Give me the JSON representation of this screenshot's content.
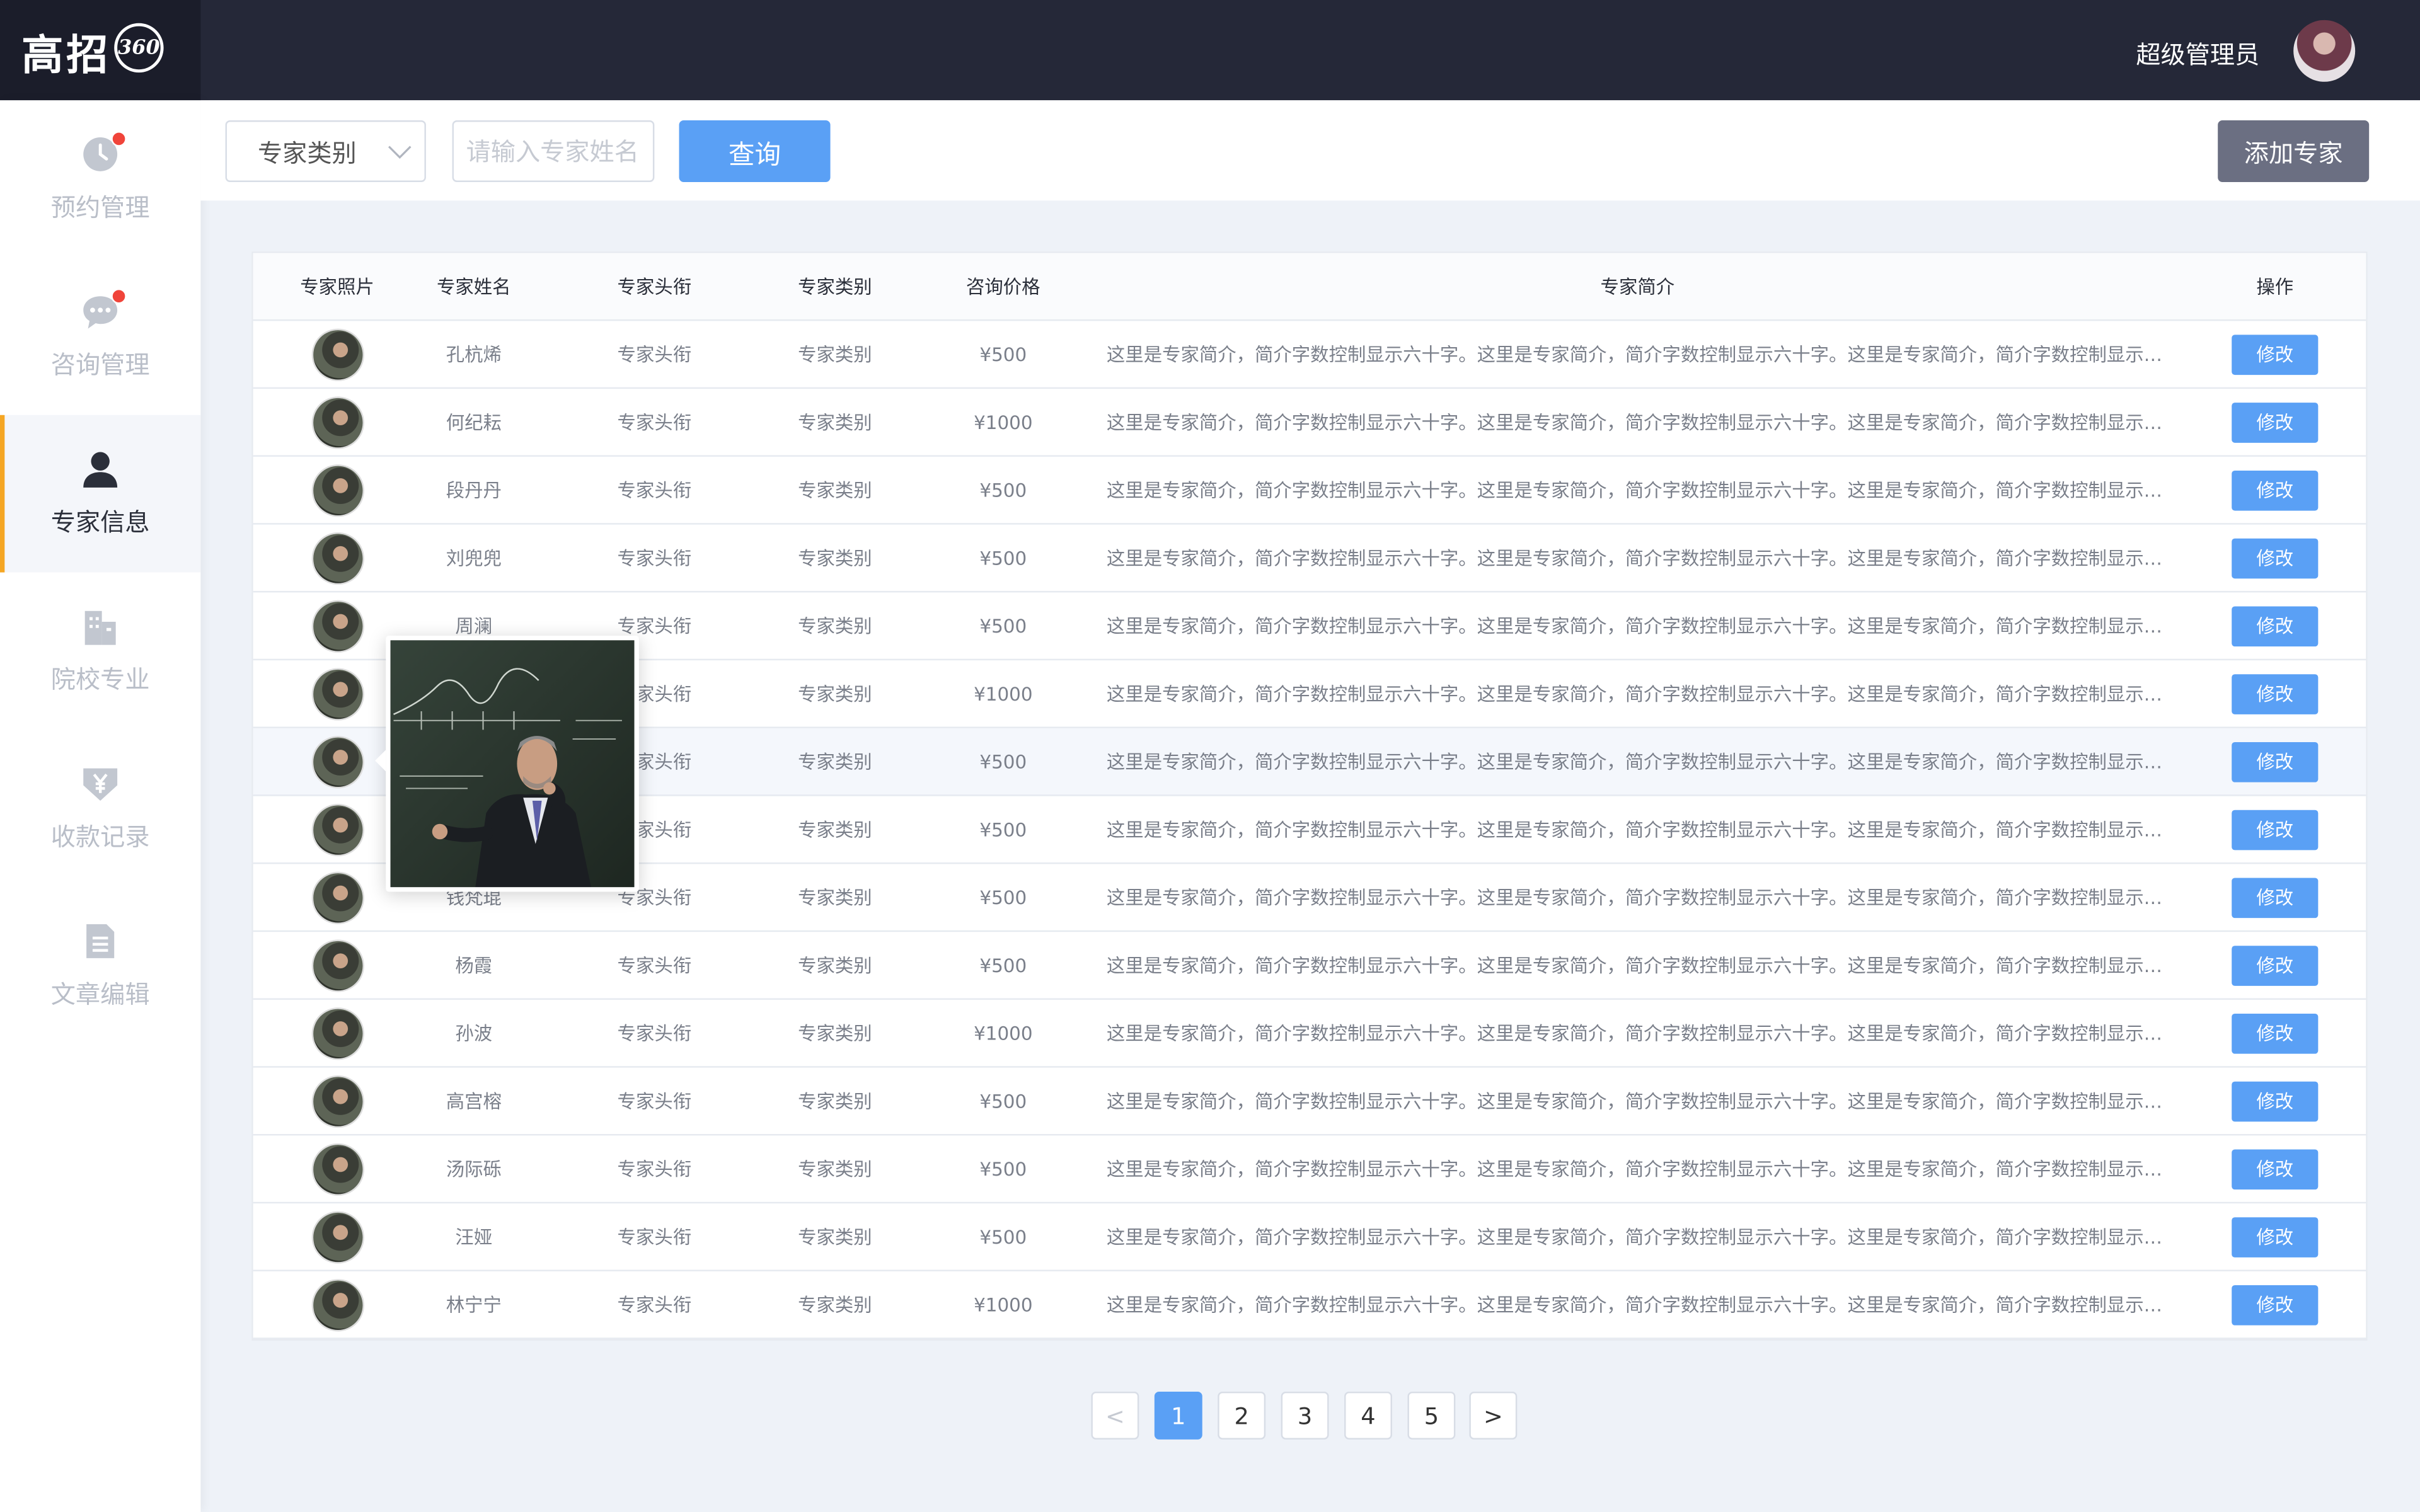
{
  "brand": {
    "logo_text": "高招",
    "logo_badge": "360"
  },
  "header": {
    "admin_name": "超级管理员"
  },
  "sidebar": {
    "items": [
      {
        "label": "预约管理",
        "icon": "clock-icon",
        "badge_dot": true
      },
      {
        "label": "咨询管理",
        "icon": "chat-bubble-icon",
        "badge_dot": true
      },
      {
        "label": "专家信息",
        "icon": "user-icon",
        "active": true
      },
      {
        "label": "院校专业",
        "icon": "building-icon"
      },
      {
        "label": "收款记录",
        "icon": "yen-shield-icon"
      },
      {
        "label": "文章编辑",
        "icon": "document-icon"
      }
    ]
  },
  "toolbar": {
    "category_select": "专家类别",
    "search_placeholder": "请输入专家姓名",
    "query_label": "查询",
    "add_label": "添加专家"
  },
  "table": {
    "headers": {
      "photo": "专家照片",
      "name": "专家姓名",
      "title": "专家头衔",
      "type": "专家类别",
      "price": "咨询价格",
      "intro": "专家简介",
      "op": "操作"
    },
    "rows": [
      {
        "name": "孔杭烯",
        "title": "专家头衔",
        "type": "专家类别",
        "price": "¥500",
        "intro": "这里是专家简介，简介字数控制显示六十字。这里是专家简介，简介字数控制显示六十字。这里是专家简介，简介字数控制显示六十字...",
        "op": "修改"
      },
      {
        "name": "何纪耘",
        "title": "专家头衔",
        "type": "专家类别",
        "price": "¥1000",
        "intro": "这里是专家简介，简介字数控制显示六十字。这里是专家简介，简介字数控制显示六十字。这里是专家简介，简介字数控制显示六十字...",
        "op": "修改"
      },
      {
        "name": "段丹丹",
        "title": "专家头衔",
        "type": "专家类别",
        "price": "¥500",
        "intro": "这里是专家简介，简介字数控制显示六十字。这里是专家简介，简介字数控制显示六十字。这里是专家简介，简介字数控制显示六十字...",
        "op": "修改"
      },
      {
        "name": "刘兜兜",
        "title": "专家头衔",
        "type": "专家类别",
        "price": "¥500",
        "intro": "这里是专家简介，简介字数控制显示六十字。这里是专家简介，简介字数控制显示六十字。这里是专家简介，简介字数控制显示六十字...",
        "op": "修改"
      },
      {
        "name": "周澜",
        "title": "专家头衔",
        "type": "专家类别",
        "price": "¥500",
        "intro": "这里是专家简介，简介字数控制显示六十字。这里是专家简介，简介字数控制显示六十字。这里是专家简介，简介字数控制显示六十字...",
        "op": "修改"
      },
      {
        "name": "",
        "title": "专家头衔",
        "type": "专家类别",
        "price": "¥1000",
        "intro": "这里是专家简介，简介字数控制显示六十字。这里是专家简介，简介字数控制显示六十字。这里是专家简介，简介字数控制显示六十字...",
        "op": "修改"
      },
      {
        "name": "",
        "title": "专家头衔",
        "type": "专家类别",
        "price": "¥500",
        "intro": "这里是专家简介，简介字数控制显示六十字。这里是专家简介，简介字数控制显示六十字。这里是专家简介，简介字数控制显示六十字...",
        "op": "修改",
        "highlight": true
      },
      {
        "name": "",
        "title": "专家头衔",
        "type": "专家类别",
        "price": "¥500",
        "intro": "这里是专家简介，简介字数控制显示六十字。这里是专家简介，简介字数控制显示六十字。这里是专家简介，简介字数控制显示六十字...",
        "op": "修改"
      },
      {
        "name": "钱梵琨",
        "title": "专家头衔",
        "type": "专家类别",
        "price": "¥500",
        "intro": "这里是专家简介，简介字数控制显示六十字。这里是专家简介，简介字数控制显示六十字。这里是专家简介，简介字数控制显示六十字...",
        "op": "修改"
      },
      {
        "name": "杨霞",
        "title": "专家头衔",
        "type": "专家类别",
        "price": "¥500",
        "intro": "这里是专家简介，简介字数控制显示六十字。这里是专家简介，简介字数控制显示六十字。这里是专家简介，简介字数控制显示六十字...",
        "op": "修改"
      },
      {
        "name": "孙波",
        "title": "专家头衔",
        "type": "专家类别",
        "price": "¥1000",
        "intro": "这里是专家简介，简介字数控制显示六十字。这里是专家简介，简介字数控制显示六十字。这里是专家简介，简介字数控制显示六十字...",
        "op": "修改"
      },
      {
        "name": "高宫榕",
        "title": "专家头衔",
        "type": "专家类别",
        "price": "¥500",
        "intro": "这里是专家简介，简介字数控制显示六十字。这里是专家简介，简介字数控制显示六十字。这里是专家简介，简介字数控制显示六十字...",
        "op": "修改"
      },
      {
        "name": "汤际砾",
        "title": "专家头衔",
        "type": "专家类别",
        "price": "¥500",
        "intro": "这里是专家简介，简介字数控制显示六十字。这里是专家简介，简介字数控制显示六十字。这里是专家简介，简介字数控制显示六十字...",
        "op": "修改"
      },
      {
        "name": "汪娅",
        "title": "专家头衔",
        "type": "专家类别",
        "price": "¥500",
        "intro": "这里是专家简介，简介字数控制显示六十字。这里是专家简介，简介字数控制显示六十字。这里是专家简介，简介字数控制显示六十字...",
        "op": "修改"
      },
      {
        "name": "林宁宁",
        "title": "专家头衔",
        "type": "专家类别",
        "price": "¥1000",
        "intro": "这里是专家简介，简介字数控制显示六十字。这里是专家简介，简介字数控制显示六十字。这里是专家简介，简介字数控制显示六十字...",
        "op": "修改"
      }
    ]
  },
  "pagination": {
    "prev": "<",
    "next": ">",
    "pages": [
      "1",
      "2",
      "3",
      "4",
      "5"
    ],
    "current": "1"
  },
  "popover": {
    "image": "expert-photo-lecturer-at-chalkboard"
  },
  "colors": {
    "primary": "#5aa0f5",
    "topbar": "#252838",
    "add_button": "#6b6f82",
    "active_indicator": "#f5a623",
    "badge": "#f0443a"
  }
}
